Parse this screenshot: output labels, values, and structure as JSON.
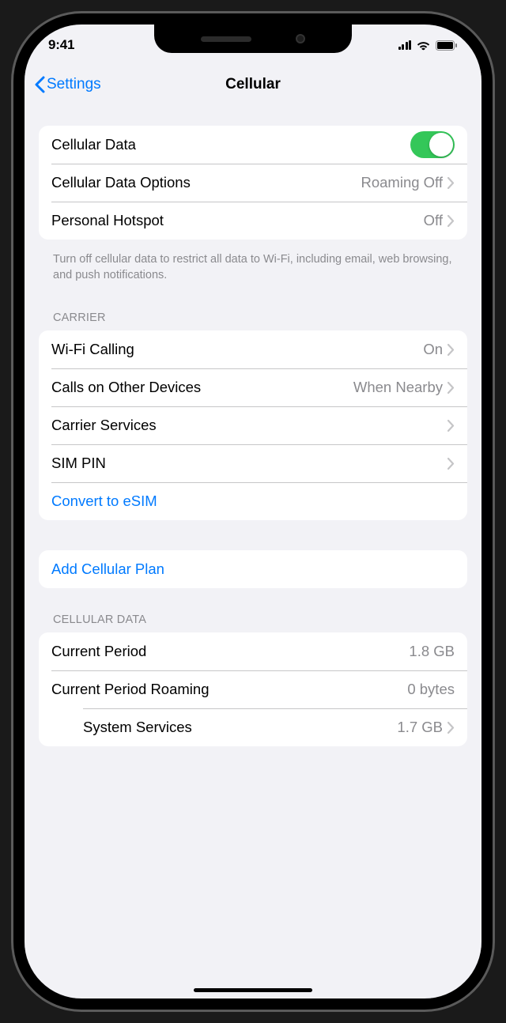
{
  "status": {
    "time": "9:41"
  },
  "nav": {
    "back": "Settings",
    "title": "Cellular"
  },
  "section1": {
    "cellular_data": "Cellular Data",
    "cellular_data_on": true,
    "options_label": "Cellular Data Options",
    "options_detail": "Roaming Off",
    "hotspot_label": "Personal Hotspot",
    "hotspot_detail": "Off",
    "footer": "Turn off cellular data to restrict all data to Wi-Fi, including email, web browsing, and push notifications."
  },
  "carrier": {
    "header": "CARRIER",
    "wifi_calling_label": "Wi-Fi Calling",
    "wifi_calling_detail": "On",
    "other_devices_label": "Calls on Other Devices",
    "other_devices_detail": "When Nearby",
    "carrier_services": "Carrier Services",
    "sim_pin": "SIM PIN",
    "convert_esim": "Convert to eSIM"
  },
  "add_plan": "Add Cellular Plan",
  "usage": {
    "header": "CELLULAR DATA",
    "current_period_label": "Current Period",
    "current_period_value": "1.8 GB",
    "roaming_label": "Current Period Roaming",
    "roaming_value": "0 bytes",
    "system_services_label": "System Services",
    "system_services_value": "1.7 GB"
  }
}
